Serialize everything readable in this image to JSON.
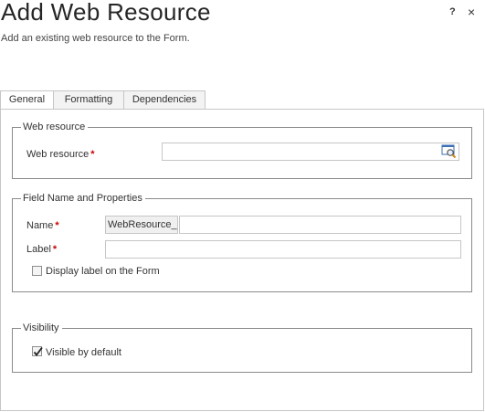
{
  "dialog": {
    "title": "Add Web Resource",
    "subtitle": "Add an existing web resource to the Form.",
    "help_label": "?",
    "close_label": "×"
  },
  "tabs": [
    {
      "label": "General",
      "active": true
    },
    {
      "label": "Formatting",
      "active": false
    },
    {
      "label": "Dependencies",
      "active": false
    }
  ],
  "web_resource_section": {
    "legend": "Web resource",
    "field_label": "Web resource",
    "required_mark": "*",
    "value": "",
    "lookup_icon": "lookup-icon"
  },
  "field_props_section": {
    "legend": "Field Name and Properties",
    "name_label": "Name",
    "name_prefix": "WebResource_",
    "name_value": "",
    "label_label": "Label",
    "label_value": "",
    "required_mark": "*",
    "display_label_checkbox": {
      "label": "Display label on the Form",
      "checked": false
    }
  },
  "visibility_section": {
    "legend": "Visibility",
    "visible_checkbox": {
      "label": "Visible by default",
      "checked": true
    }
  },
  "colors": {
    "required": "#cc0000",
    "border": "#8a8a8a"
  }
}
